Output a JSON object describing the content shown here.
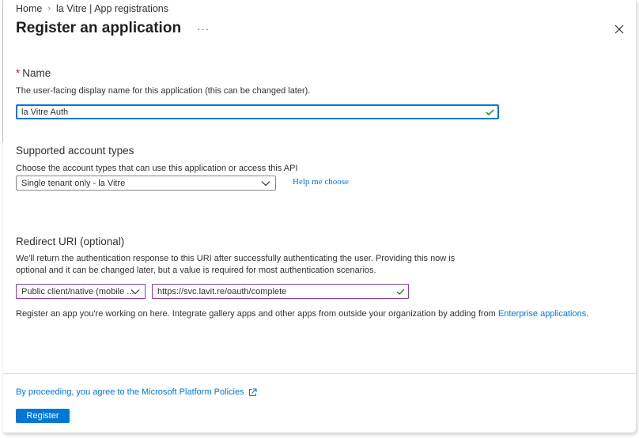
{
  "breadcrumb": {
    "home": "Home",
    "separator": "›",
    "current": "la Vitre | App registrations"
  },
  "header": {
    "title": "Register an application",
    "more": "···"
  },
  "name_section": {
    "required_marker": "*",
    "label": "Name",
    "description": "The user-facing display name for this application (this can be changed later).",
    "value": "la Vitre Auth"
  },
  "account_types": {
    "label": "Supported account types",
    "description": "Choose the account types that can use this application or access this API",
    "selected": "Single tenant only - la Vitre",
    "help_link": "Help me choose"
  },
  "redirect": {
    "label": "Redirect URI (optional)",
    "description_line1": "We'll return the authentication response to this URI after successfully authenticating the user. Providing this now is",
    "description_line2": "optional and it can be changed later, but a value is required for most authentication scenarios.",
    "platform_selected": "Public client/native (mobile ...",
    "uri_value": "https://svc.lavit.re/oauth/complete"
  },
  "gallery_note": {
    "text": "Register an app you're working on here. Integrate gallery apps and other apps from outside your organization by adding from ",
    "link": "Enterprise applications",
    "suffix": "."
  },
  "footer": {
    "policy_text": "By proceeding, you agree to the Microsoft Platform Policies",
    "register_label": "Register"
  },
  "colors": {
    "accent": "#0078d4",
    "valid_check": "#107c10",
    "required": "#a4262c",
    "field_border_purple": "#8a3fa0"
  },
  "icons": [
    "close-icon",
    "checkmark-icon",
    "chevron-down-icon",
    "external-link-icon"
  ]
}
